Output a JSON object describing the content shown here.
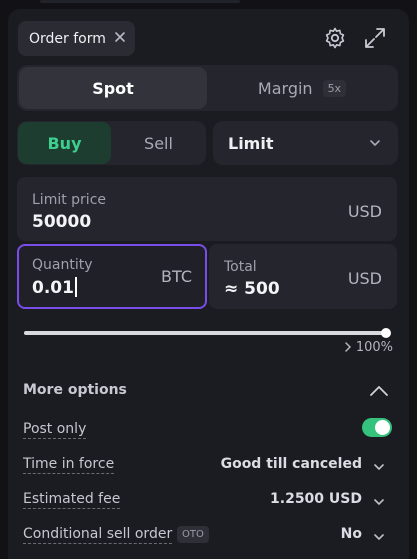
{
  "header": {
    "tab_label": "Order form",
    "icons": [
      "close-icon",
      "gear-icon",
      "expand-icon"
    ]
  },
  "mode_tabs": {
    "spot": "Spot",
    "margin": "Margin",
    "margin_badge": "5x"
  },
  "side_toggle": {
    "buy": "Buy",
    "sell": "Sell"
  },
  "order_type": {
    "selected": "Limit"
  },
  "limit_price": {
    "label": "Limit price",
    "value": "50000",
    "unit": "USD"
  },
  "quantity": {
    "label": "Quantity",
    "value": "0.01",
    "unit": "BTC"
  },
  "total": {
    "label": "Total",
    "value": "≈ 500",
    "unit": "USD"
  },
  "slider": {
    "percent_value": 100,
    "percent_label": "100%"
  },
  "more_options": {
    "title": "More options",
    "rows": [
      {
        "key": "Post only",
        "toggle_on": true
      },
      {
        "key": "Time in force",
        "value": "Good till canceled"
      },
      {
        "key": "Estimated fee",
        "value": "1.2500 USD"
      },
      {
        "key": "Conditional sell order",
        "badge": "OTO",
        "value": "No"
      }
    ]
  },
  "colors": {
    "buy_green": "#3ecf8e",
    "focus_purple": "#7b4de8",
    "toggle_green": "#34c27c"
  }
}
